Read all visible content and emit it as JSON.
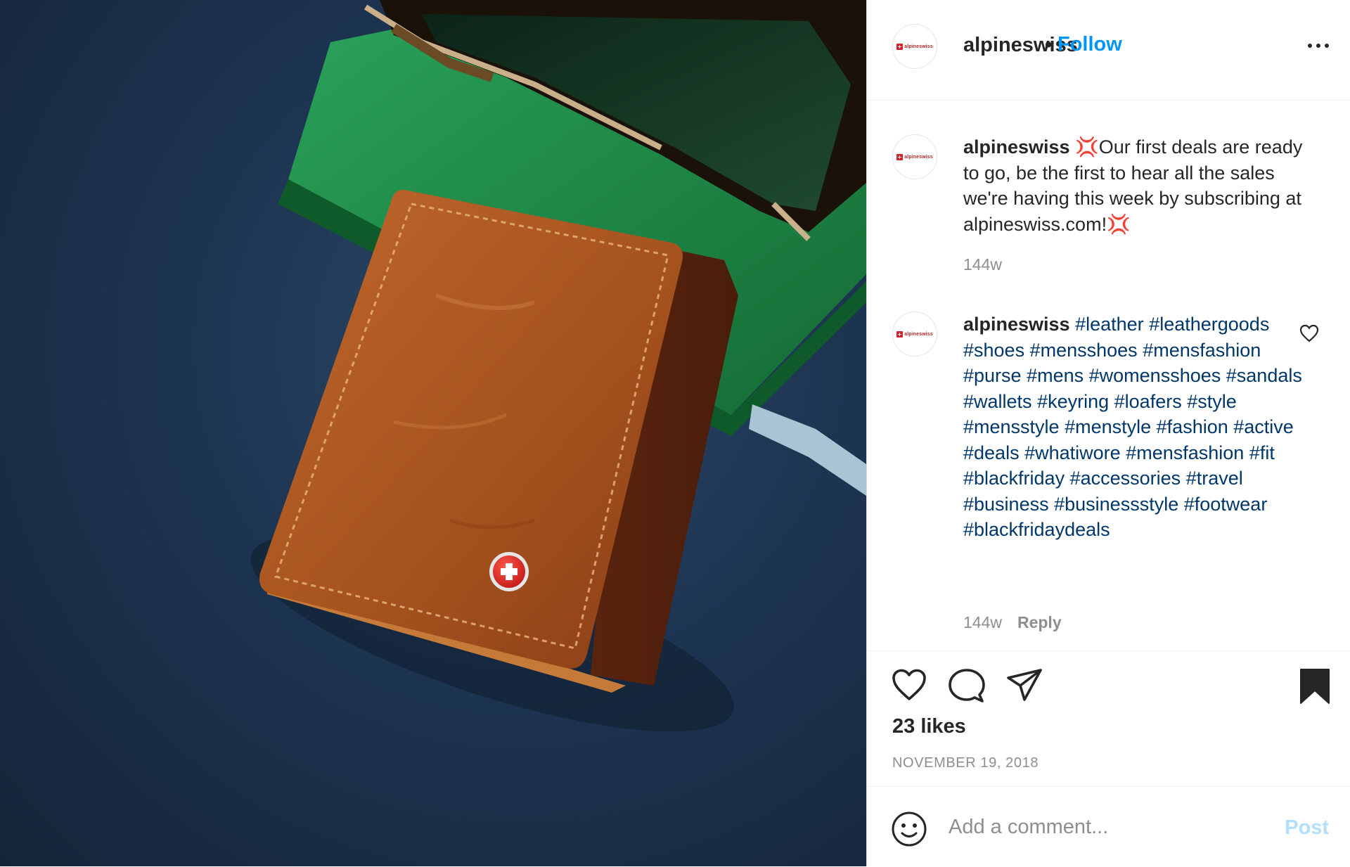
{
  "header": {
    "avatar_text": "alpineswiss",
    "username": "alpineswiss",
    "separator": "•",
    "follow_label": "Follow"
  },
  "comments": [
    {
      "avatar_text": "alpineswiss",
      "username": "alpineswiss",
      "emoji": "💢",
      "text": "Our first deals are ready to go, be the first to hear all the sales we're having this week by subscribing at alpineswiss.com!",
      "time": "144w"
    },
    {
      "avatar_text": "alpineswiss",
      "username": "alpineswiss",
      "hashtags": [
        "#leather",
        "#leathergoods",
        "#shoes",
        "#mensshoes",
        "#mensfashion",
        "#purse",
        "#mens",
        "#womensshoes",
        "#sandals",
        "#wallets",
        "#keyring",
        "#loafers",
        "#style",
        "#mensstyle",
        "#menstyle",
        "#fashion",
        "#active",
        "#deals",
        "#whatiwore",
        "#mensfashion",
        "#fit",
        "#blackfriday",
        "#accessories",
        "#travel",
        "#business",
        "#businessstyle",
        "#footwear",
        "#blackfridaydeals"
      ],
      "time": "144w",
      "reply_label": "Reply"
    }
  ],
  "actions": {
    "likes": "23 likes",
    "date": "NOVEMBER 19, 2018"
  },
  "add_comment": {
    "placeholder": "Add a comment...",
    "post_label": "Post"
  },
  "colors": {
    "link_blue": "#0095f6",
    "hashtag": "#00376b",
    "muted": "#8e8e8e",
    "post_disabled": "#b2dffc",
    "wallet": "#a85525",
    "notebook": "#1f8c45",
    "background": "#1d3451"
  }
}
